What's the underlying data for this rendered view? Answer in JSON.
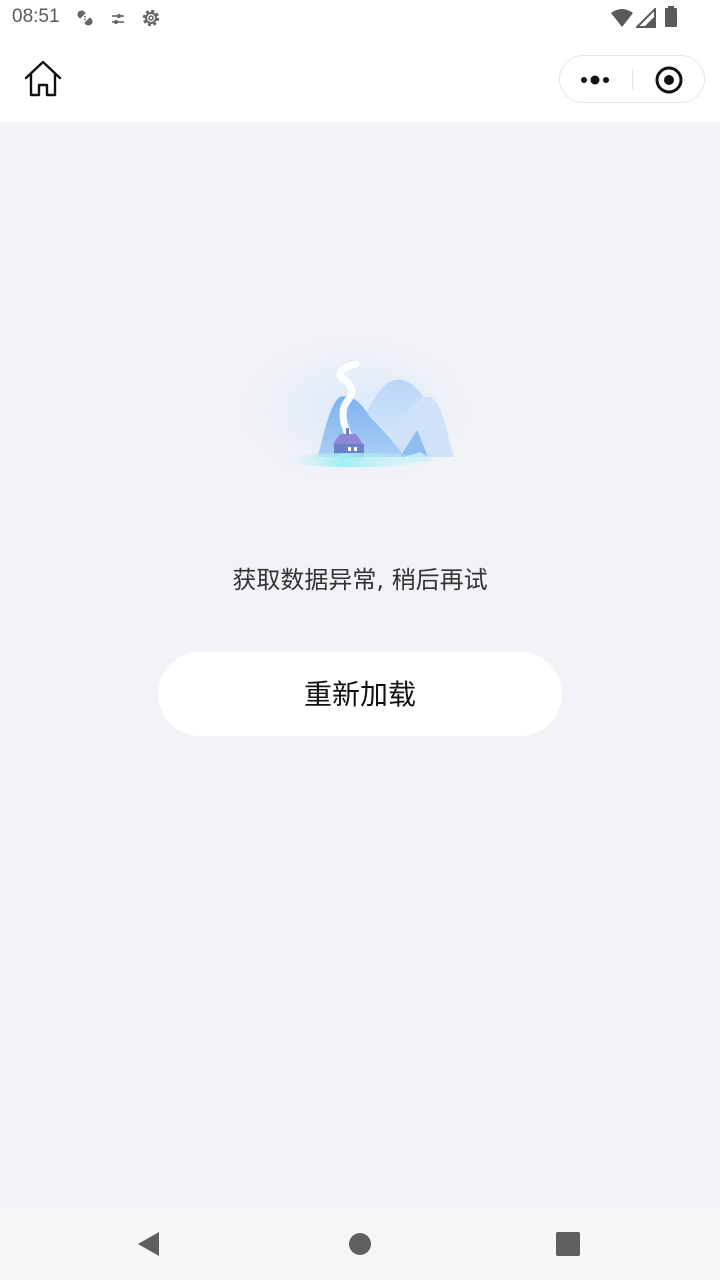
{
  "status_bar": {
    "time": "08:51",
    "left_icons": [
      "bandage-icon",
      "tune-icon",
      "settings-gear-icon"
    ],
    "right_icons": [
      "wifi-icon",
      "signal-icon",
      "battery-icon"
    ]
  },
  "nav_bar": {
    "home_icon": "home-icon",
    "capsule": {
      "more_icon": "more-dots-icon",
      "close_icon": "target-close-icon"
    }
  },
  "main": {
    "illustration": "mountain-house-illustration",
    "error_message": "获取数据异常, 稍后再试",
    "reload_label": "重新加载"
  },
  "system_nav": {
    "back_icon": "back-triangle-icon",
    "home_icon": "home-circle-icon",
    "recents_icon": "recents-square-icon"
  }
}
